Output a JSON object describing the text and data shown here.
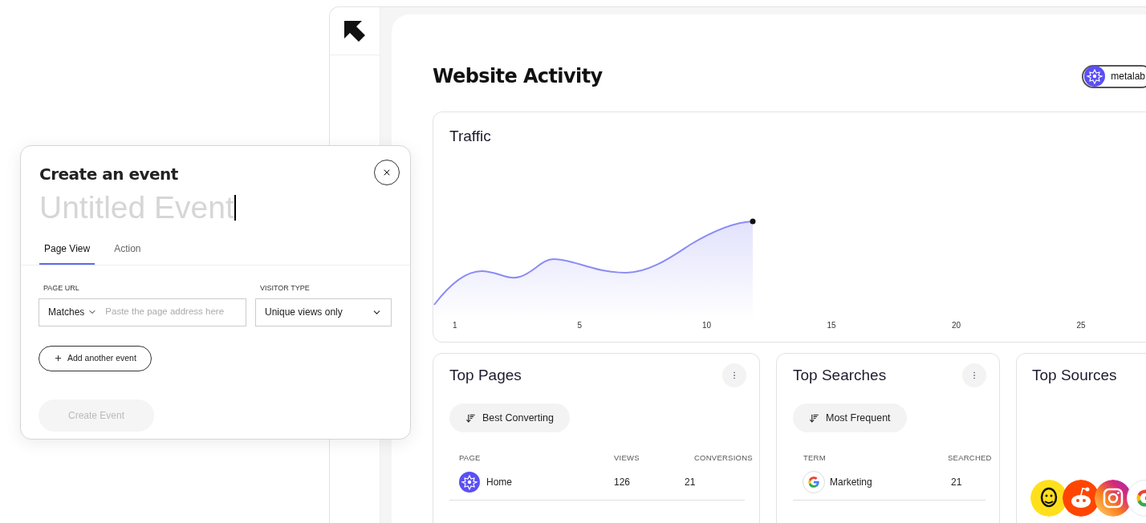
{
  "header": {
    "title": "Website Activity",
    "account": {
      "name": "metalab"
    }
  },
  "traffic": {
    "title": "Traffic",
    "x_labels": [
      "1",
      "5",
      "10",
      "15",
      "20",
      "25"
    ]
  },
  "top_pages": {
    "title": "Top Pages",
    "sort": "Best Converting",
    "columns": [
      "PAGE",
      "VIEWS",
      "CONVERSIONS"
    ],
    "rows": [
      {
        "cells": [
          "Home",
          "126",
          "21"
        ]
      }
    ]
  },
  "top_searches": {
    "title": "Top Searches",
    "sort": "Most Frequent",
    "columns": [
      "TERM",
      "SEARCHED"
    ],
    "rows": [
      {
        "cells": [
          "Marketing",
          "21"
        ]
      }
    ]
  },
  "top_sources": {
    "title": "Top Sources",
    "sources": [
      {
        "kind": "chimp"
      },
      {
        "kind": "alien"
      },
      {
        "kind": "camera"
      },
      {
        "kind": "g"
      }
    ]
  },
  "dialog": {
    "title": "Create an event",
    "name_field": {
      "placeholder": "Untitled Event"
    },
    "tabs": [
      {
        "label": "Page View",
        "selected": true
      },
      {
        "label": "Action",
        "selected": false
      }
    ],
    "page_url": {
      "label": "PAGE URL",
      "match": "Matches",
      "placeholder": "Paste the page address here"
    },
    "visitor_type": {
      "label": "VISITOR TYPE",
      "value": "Unique views only"
    },
    "add_button": "Add another event",
    "submit": {
      "label": "Create Event",
      "disabled": true
    }
  }
}
